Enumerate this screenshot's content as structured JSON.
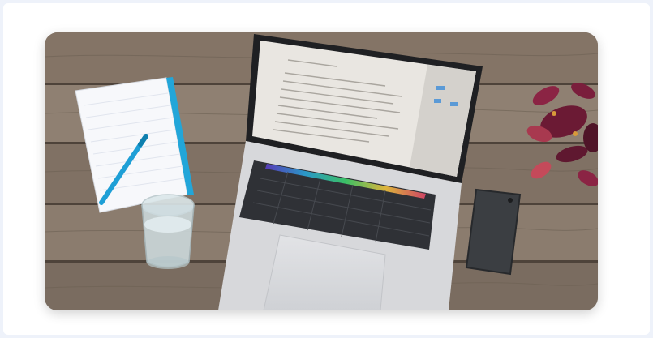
{
  "image": {
    "subject": "laptop-on-wooden-desk",
    "colors": {
      "wood": "#8a7a6c",
      "wood_dark": "#5f5247",
      "laptop_body": "#d7d8db",
      "keyboard": "#2f3136",
      "screen": "#e9e6e1",
      "pen": "#1e9fd6",
      "plant": "#7a1e3c",
      "phone": "#3b3e42"
    }
  }
}
